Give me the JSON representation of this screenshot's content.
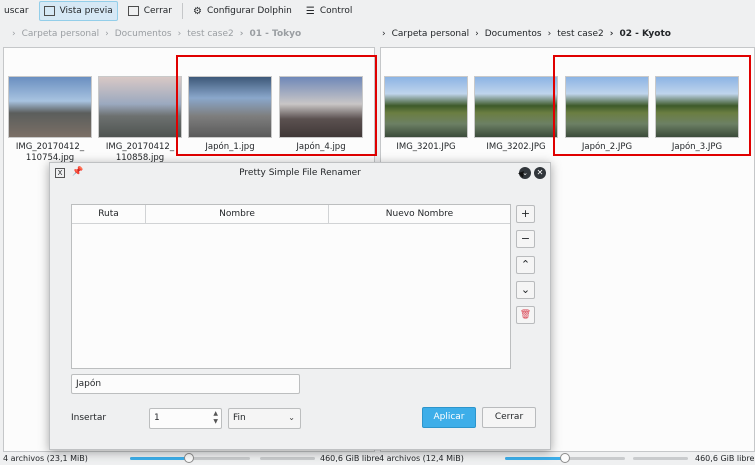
{
  "toolbar": {
    "search_label": "uscar",
    "preview_label": "Vista previa",
    "close_label": "Cerrar",
    "configure_label": "Configurar Dolphin",
    "control_label": "Control"
  },
  "left_pane": {
    "breadcrumb": [
      "Carpeta personal",
      "Documentos",
      "test case2",
      "01 - Tokyo"
    ],
    "files": [
      {
        "name": "IMG_20170412_110754.jpg",
        "line1": "IMG_20170412_",
        "line2": "110754.jpg"
      },
      {
        "name": "IMG_20170412_110858.jpg",
        "line1": "IMG_20170412_",
        "line2": "110858.jpg"
      },
      {
        "name": "Japón_1.jpg",
        "line1": "Japón_1.jpg",
        "line2": ""
      },
      {
        "name": "Japón_4.jpg",
        "line1": "Japón_4.jpg",
        "line2": ""
      }
    ]
  },
  "right_pane": {
    "breadcrumb": [
      "Carpeta personal",
      "Documentos",
      "test case2",
      "02 - Kyoto"
    ],
    "files": [
      {
        "line1": "IMG_3201.JPG"
      },
      {
        "line1": "IMG_3202.JPG"
      },
      {
        "line1": "Japón_2.JPG"
      },
      {
        "line1": "Japón_3.JPG"
      }
    ]
  },
  "status": {
    "left_count": "4 archivos (23,1 MiB)",
    "left_free": "460,6 GiB libre",
    "right_count": "4 archivos (12,4 MiB)",
    "right_free": "460,6 GiB libre"
  },
  "dialog": {
    "title": "Pretty Simple File Renamer",
    "columns": [
      "Ruta",
      "Nombre",
      "Nuevo Nombre"
    ],
    "name_value": "Japón",
    "insert_label": "Insertar",
    "insert_value": "1",
    "position_value": "Fin",
    "apply_label": "Aplicar",
    "close_label": "Cerrar"
  },
  "colors": {
    "highlight_box": "#e00000",
    "accent": "#3daee9"
  }
}
